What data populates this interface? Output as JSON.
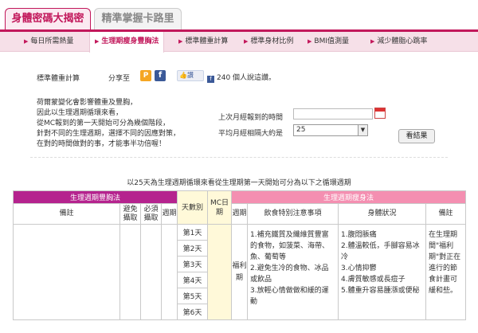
{
  "top_tabs": [
    {
      "label": "身體密碼大揭密",
      "active": true
    },
    {
      "label": "精準掌握卡路里",
      "active": false
    }
  ],
  "subnav": [
    {
      "label": "每日所需熱量",
      "active": false
    },
    {
      "label": "生理期瘦身豐胸法",
      "active": true
    },
    {
      "label": "標準體重計算",
      "active": false
    },
    {
      "label": "標準身材比例",
      "active": false
    },
    {
      "label": "BMI值測量",
      "active": false
    },
    {
      "label": "減少體脂心跳率",
      "active": false
    }
  ],
  "calculator": {
    "title": "標準體重計算",
    "share_label": "分享至",
    "like_label": "讚",
    "like_count_text": "240 個人說這讚。",
    "description": [
      "荷爾蒙變化會影響體重及豐胸，",
      "因此以生理週期循環來看，",
      "從MC報到的第一天開始可分為幾個階段，",
      "針對不同的生理週期，選擇不同的因應對策，",
      "在對的時間做對的事，才能事半功倍喔！"
    ],
    "last_period_label": "上次月經報到的時間",
    "last_period_value": "",
    "avg_cycle_label": "平均月經相隔大約是",
    "avg_cycle_value": "25",
    "result_button": "看結果"
  },
  "caption": "以25天為生理週期循環來看從生理期第一天開始可分為以下之循環週期",
  "table": {
    "left_group": "生理週期豐胸法",
    "right_group": "生理週期瘦身法",
    "left_cols": [
      "備註",
      "避免攝取",
      "必須攝取",
      "週期"
    ],
    "day_col": "天數別",
    "mc_col": "MC日期",
    "right_cols": [
      "週期",
      "飲食特別注意事項",
      "身體狀況",
      "備註"
    ],
    "days": [
      "第1天",
      "第2天",
      "第3天",
      "第4天",
      "第5天",
      "第6天"
    ],
    "period_name": "福利期",
    "diet_notes": [
      "1.補充鐵質及纖維質豐富的食物，如菠菜、海帶、魚、葡萄等",
      "2.避免生冷的食物、冰品或飲品",
      "3.放輕心情做做和緩的運動"
    ],
    "body_status": [
      "1.腹悶脹痛",
      "2.體溫較低，手腳容易冰冷",
      "3.心情抑鬱",
      "4.膚質敏感或長痘子",
      "5.體重升容易腫漲或便秘"
    ],
    "right_note": "在生理期間\"福利期\"對正在進行的節食計畫可緩和些。"
  }
}
